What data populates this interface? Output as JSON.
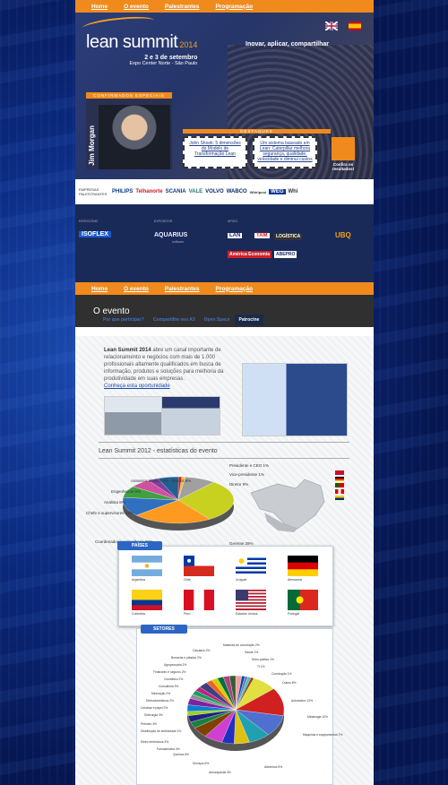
{
  "nav": [
    "Home",
    "O evento",
    "Palestrantes",
    "Programação"
  ],
  "header": {
    "logo_text": "lean summit",
    "logo_year": "2014",
    "date": "2 e 3 de setembro",
    "venue": "Expo Center Norte - São Paulo",
    "tagline": "Inovar, aplicar, compartilhar",
    "confirmed_label": "CONFIRMADOS ESPECIAIS",
    "speaker_name": "Jim Morgan",
    "highlights_label": "DESTAQUES",
    "highlight_1": "John Shook: 5 dimensões do Modelo de Transformação Lean",
    "highlight_2": "Um sistema baseado em Lean: Caterpillar melhora segurança, qualidade, velocidade e diminui custos",
    "a3_label": "Confira os resultados!"
  },
  "sponsors": {
    "label": "EMPRESAS PALESTRANTES",
    "logos": [
      "PHILIPS",
      "Telhanorte",
      "SCANIA",
      "VALE",
      "VOLVO",
      "WABCO",
      "Whirlpool",
      "WEG",
      "Whi"
    ]
  },
  "partners": {
    "patrocinio_label": "PATROCÍNIO",
    "patrocinio": "ISOFLEX",
    "expositor_label": "EXPOSITOR",
    "expositor": "AQUARIUS",
    "expositor_sub": "software",
    "apoio_label": "APOIO",
    "apoio": [
      "LAN",
      "TAM",
      "LOGÍSTICA",
      "UBQ",
      "América Economia",
      "ABEPRO"
    ]
  },
  "page": {
    "title": "O evento",
    "tabs": [
      "Por que participar?",
      "Compartilhe seu A3",
      "Open Space",
      "Patrocine"
    ],
    "active_tab": "Patrocine",
    "intro_bold": "Lean Summit 2014",
    "intro_text": " abre um canal importante de relacionamento e negócios com mais de 1.000 profissionais altamente qualificados em busca de informação, produtos e soluções para melhoria da produtividade em suas empresas.",
    "intro_link": "Conheça esta oportunidade",
    "stats_title": "Lean Summit 2012 - estatísticas do evento"
  },
  "chart_data": [
    {
      "type": "pie",
      "title": "Lean Summit 2012 - estatísticas do evento",
      "categories": [
        "Presidente e CEO",
        "Vice-presidente",
        "Diretor",
        "Gerente",
        "Coordenador lean/melhoria",
        "Chefe e supervisores",
        "Analista",
        "Engenheiros",
        "Assessor técnico",
        "Outros"
      ],
      "values": [
        1,
        1,
        9,
        29,
        23,
        13,
        8,
        6,
        3,
        6
      ]
    },
    {
      "type": "pie",
      "title": "SETORES",
      "categories": [
        "Materiais de construção",
        "Saúde",
        "Setor público",
        "TI",
        "Construção",
        "Outros",
        "Automotivo",
        "Metalurgia",
        "Máquinas e equipamentos",
        "Alimentos",
        "Aeroespacial",
        "Serviços",
        "Química",
        "Farmacêutica",
        "Eletro eletrônicos",
        "Distribuição de eletricidade",
        "Petróleo",
        "Siderurgia",
        "Celulose e papel",
        "Eletrodomésticos",
        "Mineração",
        "Consultoria",
        "Cosmético",
        "Financeiro e seguros",
        "Agropecuária",
        "Borracha e plástico",
        "Calçados"
      ],
      "values": [
        2,
        1,
        1,
        1,
        1,
        8,
        13,
        10,
        7,
        5,
        4,
        6,
        5,
        3,
        3,
        2,
        3,
        3,
        2,
        2,
        2,
        3,
        2,
        2,
        2,
        2,
        2
      ]
    }
  ],
  "countries": {
    "title": "PAÍSES",
    "list": [
      "Argentina",
      "Chile",
      "Uruguai",
      "Alemanha",
      "Colômbia",
      "Peru",
      "Estados Unidos",
      "Portugal"
    ]
  },
  "colors": {
    "orange": "#f08a1c",
    "navy": "#1a2a58",
    "blue": "#2c66c4"
  }
}
